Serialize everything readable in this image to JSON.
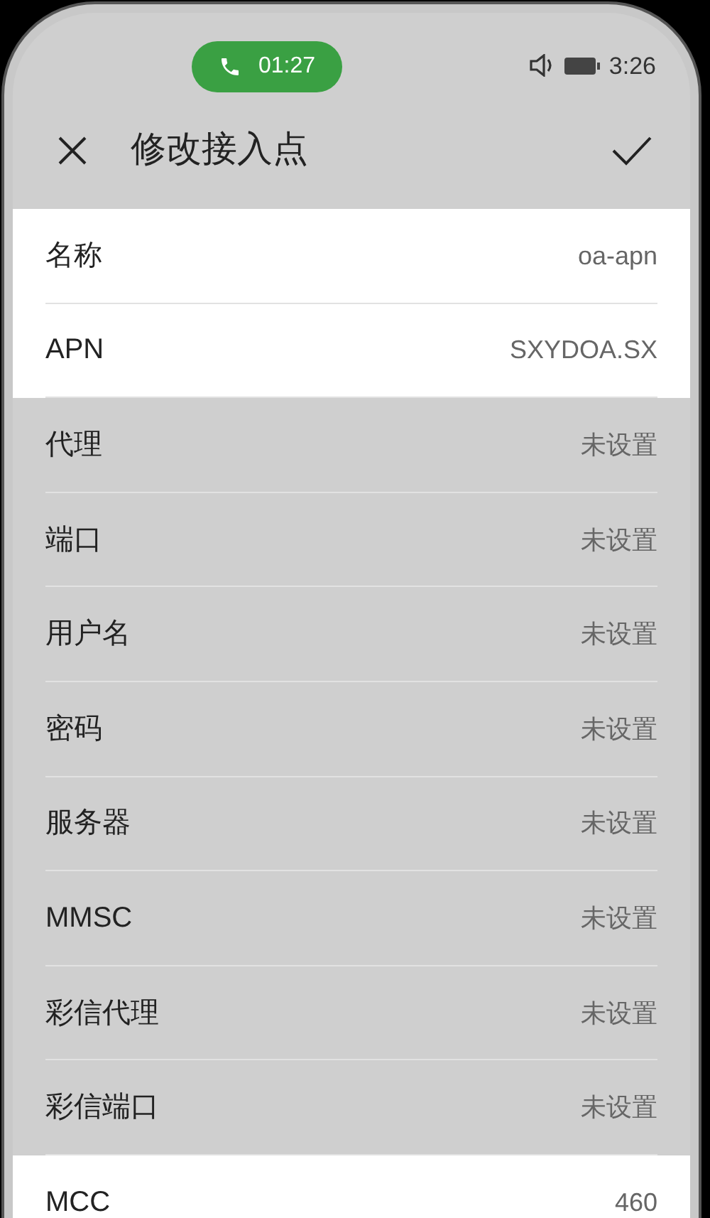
{
  "status_bar": {
    "call_timer": "01:27",
    "time": "3:26"
  },
  "header": {
    "title": "修改接入点"
  },
  "rows": [
    {
      "label": "名称",
      "value": "oa-apn",
      "highlighted": false
    },
    {
      "label": "APN",
      "value": "SXYDOA.SX",
      "highlighted": false
    },
    {
      "label": "代理",
      "value": "未设置",
      "highlighted": true
    },
    {
      "label": "端口",
      "value": "未设置",
      "highlighted": true
    },
    {
      "label": "用户名",
      "value": "未设置",
      "highlighted": true
    },
    {
      "label": "密码",
      "value": "未设置",
      "highlighted": true
    },
    {
      "label": "服务器",
      "value": "未设置",
      "highlighted": true
    },
    {
      "label": "MMSC",
      "value": "未设置",
      "highlighted": true
    },
    {
      "label": "彩信代理",
      "value": "未设置",
      "highlighted": true
    },
    {
      "label": "彩信端口",
      "value": "未设置",
      "highlighted": true
    },
    {
      "label": "MCC",
      "value": "460",
      "highlighted": false
    }
  ]
}
